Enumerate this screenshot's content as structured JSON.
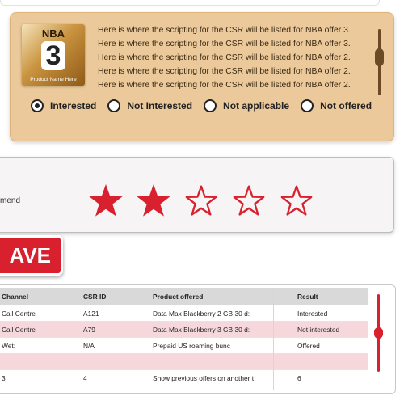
{
  "offer": {
    "badge_brand": "NBA",
    "badge_number": "3",
    "badge_caption": "Product Name Here",
    "script_text": "Here is where the scripting for the CSR will be listed for NBA offer 3. Here is where the scripting for the CSR will be listed for NBA offer 3. Here is where the scripting for the CSR will be listed for NBA offer 2. Here is where the scripting for the CSR will be listed for NBA offer 2. Here is where the scripting for the CSR will be listed for NBA offer 2.",
    "options": [
      {
        "label": "Interested",
        "checked": true
      },
      {
        "label": "Not Interested",
        "checked": false
      },
      {
        "label": "Not applicable",
        "checked": false
      },
      {
        "label": "Not offered",
        "checked": false
      }
    ]
  },
  "rating": {
    "label": "mend",
    "value": 2,
    "max": 5,
    "color": "#d8202e"
  },
  "save": {
    "label": "AVE"
  },
  "table": {
    "headers": [
      "Channel",
      "CSR ID",
      "Product offered",
      "Result"
    ],
    "rows": [
      [
        "Call Centre",
        "A121",
        "Data Max Blackberry 2 GB 30 d:",
        "Interested"
      ],
      [
        "Call Centre",
        "A79",
        "Data Max Blackberry 3 GB 30 d:",
        "Not interested"
      ],
      [
        "Wet:",
        "N/A",
        "Prepaid US roaming bunc",
        "Offered"
      ],
      [
        "",
        "",
        "",
        ""
      ],
      [
        "3",
        "4",
        "Show previous offers on another t",
        "6"
      ]
    ]
  },
  "colors": {
    "accent": "#d8202e",
    "card_bg": "#ecc99a",
    "row_pink": "#f6d8dc"
  }
}
